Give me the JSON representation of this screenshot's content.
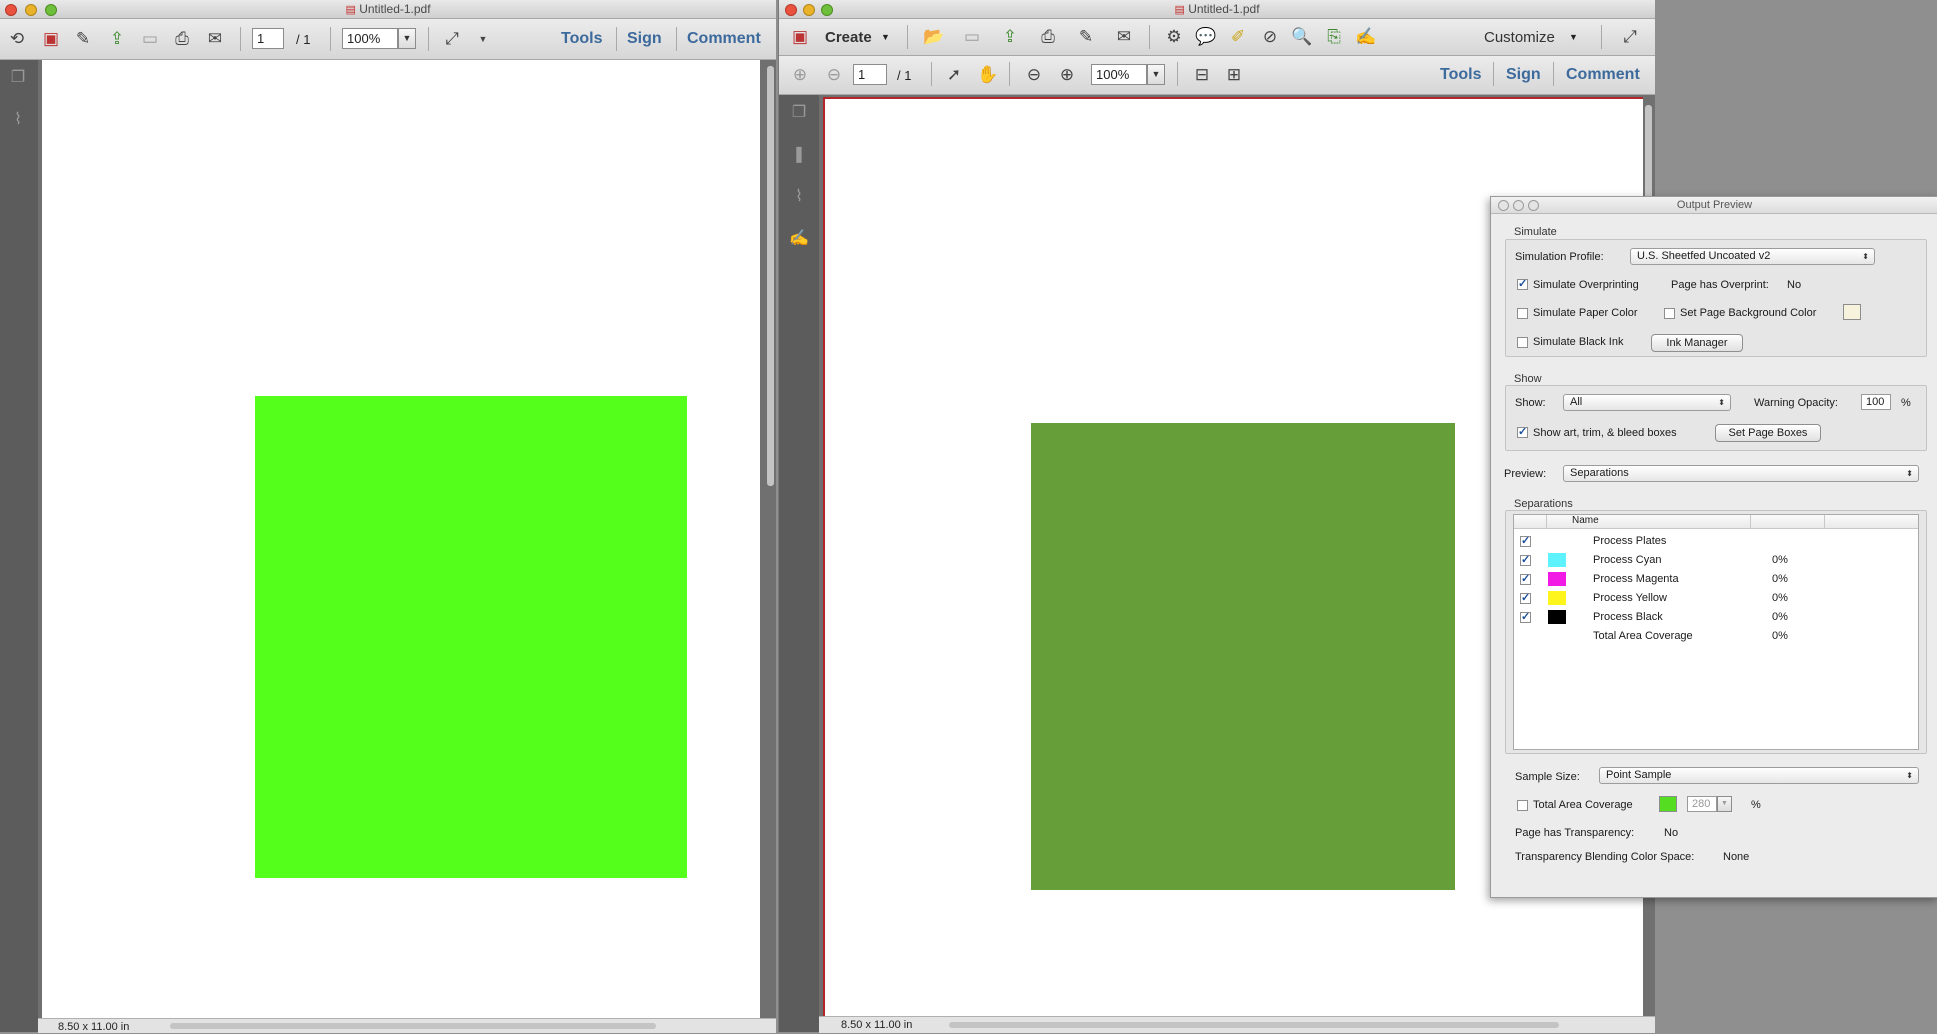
{
  "left_window": {
    "title": "Untitled-1.pdf",
    "page_current": "1",
    "page_total": "/ 1",
    "zoom": "100%",
    "tools_label": "Tools",
    "sign_label": "Sign",
    "comment_label": "Comment",
    "page_size": "8.50 x 11.00 in",
    "square_color": "#55ff1c"
  },
  "right_window": {
    "title": "Untitled-1.pdf",
    "create_label": "Create",
    "customize_label": "Customize",
    "page_current": "1",
    "page_total": "/ 1",
    "zoom": "100%",
    "tools_label": "Tools",
    "sign_label": "Sign",
    "comment_label": "Comment",
    "page_size": "8.50 x 11.00 in",
    "square_color": "#669e3a"
  },
  "output_preview": {
    "title": "Output Preview",
    "simulate_group": "Simulate",
    "simulation_profile_label": "Simulation Profile:",
    "simulation_profile_value": "U.S. Sheetfed Uncoated v2",
    "simulate_overprinting": "Simulate Overprinting",
    "page_has_overprint_label": "Page has Overprint:",
    "page_has_overprint_value": "No",
    "simulate_paper_color": "Simulate Paper Color",
    "set_page_background_color": "Set Page Background Color",
    "simulate_black_ink": "Simulate Black Ink",
    "ink_manager": "Ink Manager",
    "show_group": "Show",
    "show_label": "Show:",
    "show_value": "All",
    "warning_opacity_label": "Warning Opacity:",
    "warning_opacity_value": "100",
    "percent": "%",
    "show_boxes": "Show art, trim, & bleed boxes",
    "set_page_boxes": "Set Page Boxes",
    "preview_label": "Preview:",
    "preview_value": "Separations",
    "separations_group": "Separations",
    "name_header": "Name",
    "separations": [
      {
        "name": "Process Plates",
        "value": "",
        "color": ""
      },
      {
        "name": "Process Cyan",
        "value": "0%",
        "color": "#5ef2ff"
      },
      {
        "name": "Process Magenta",
        "value": "0%",
        "color": "#f21be6"
      },
      {
        "name": "Process Yellow",
        "value": "0%",
        "color": "#fdf51c"
      },
      {
        "name": "Process Black",
        "value": "0%",
        "color": "#000000"
      },
      {
        "name": "Total Area Coverage",
        "value": "0%",
        "color": ""
      }
    ],
    "sample_size_label": "Sample Size:",
    "sample_size_value": "Point Sample",
    "total_area_coverage": "Total Area Coverage",
    "tac_value": "280",
    "tac_swatch": "#55dd22",
    "page_has_transparency_label": "Page has Transparency:",
    "page_has_transparency_value": "No",
    "blending_label": "Transparency Blending Color Space:",
    "blending_value": "None"
  }
}
